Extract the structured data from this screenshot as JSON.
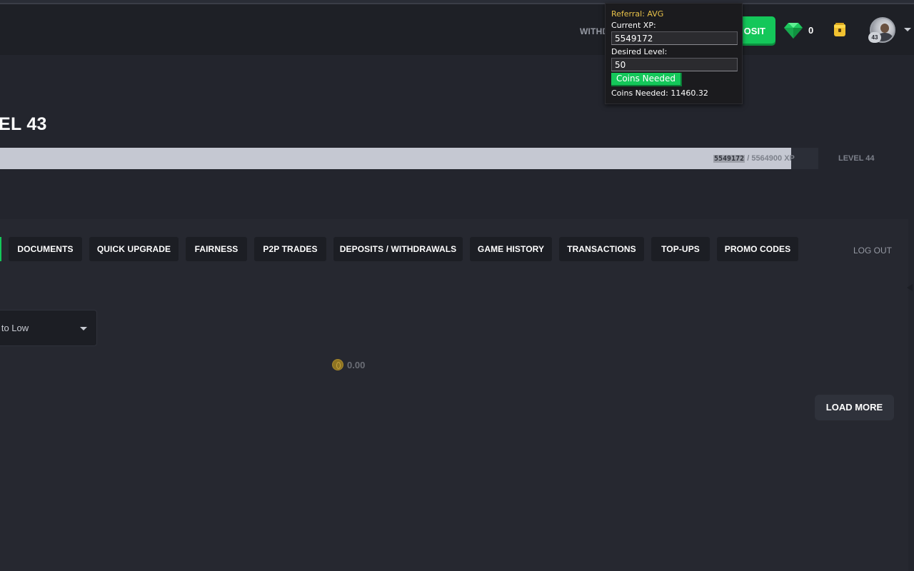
{
  "header": {
    "withdraw_label": "WITHD",
    "deposit_label": "OSIT",
    "gem_count": "0",
    "avatar_level": "43",
    "accent_color": "#14c75a"
  },
  "profile": {
    "level_title": "EL 43",
    "xp_current": "5549172",
    "xp_rest": " / 5564900 XP",
    "xp_progress": 0.967,
    "next_level": "LEVEL 44"
  },
  "tabs": [
    {
      "label": "DOCUMENTS"
    },
    {
      "label": "QUICK UPGRADE"
    },
    {
      "label": "FAIRNESS"
    },
    {
      "label": "P2P TRADES"
    },
    {
      "label": "DEPOSITS / WITHDRAWALS"
    },
    {
      "label": "GAME HISTORY"
    },
    {
      "label": "TRANSACTIONS"
    },
    {
      "label": "TOP-UPS"
    },
    {
      "label": "PROMO CODES"
    }
  ],
  "logout_label": "LOG OUT",
  "sort": {
    "value": "h to Low"
  },
  "balance": "0.00",
  "load_more_label": "LOAD MORE",
  "popup": {
    "referral": "Referral: AVG",
    "current_xp_label": "Current XP:",
    "current_xp_value": "5549172",
    "desired_level_label": "Desired Level:",
    "desired_level_value": "50",
    "button_label": "Coins Needed",
    "result": "Coins Needed: 11460.32"
  }
}
